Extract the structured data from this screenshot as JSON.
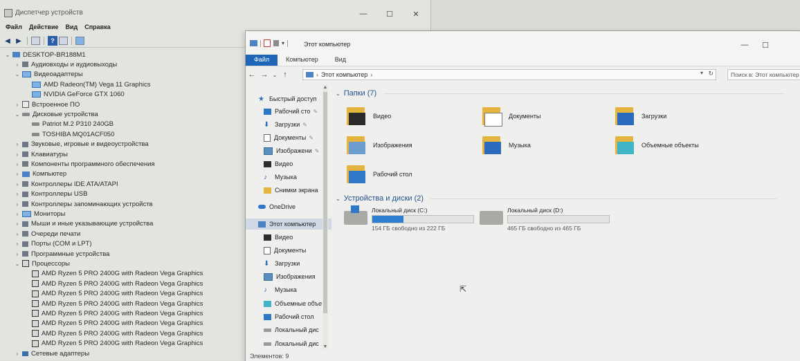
{
  "device_manager": {
    "title": "Диспетчер устройств",
    "window_controls": {
      "minimize": "—",
      "maximize": "☐",
      "close": "✕"
    },
    "menu": [
      "Файл",
      "Действие",
      "Вид",
      "Справка"
    ],
    "tree": [
      {
        "label": "DESKTOP-BR188M1",
        "level": 0,
        "expanded": true,
        "icon": "computer-icon"
      },
      {
        "label": "Аудиовходы и аудиовыходы",
        "level": 1,
        "expanded": false,
        "icon": "speaker-icon"
      },
      {
        "label": "Видеоадаптеры",
        "level": 1,
        "expanded": true,
        "icon": "monitor-icon"
      },
      {
        "label": "AMD Radeon(TM) Vega 11 Graphics",
        "level": 2,
        "icon": "monitor-icon"
      },
      {
        "label": "NVIDIA GeForce GTX 1060",
        "level": 2,
        "icon": "monitor-icon"
      },
      {
        "label": "Встроенное ПО",
        "level": 1,
        "expanded": false,
        "icon": "chip-icon"
      },
      {
        "label": "Дисковые устройства",
        "level": 1,
        "expanded": true,
        "icon": "disk-icon"
      },
      {
        "label": "Patriot M.2 P310 240GB",
        "level": 2,
        "icon": "disk-icon"
      },
      {
        "label": "TOSHIBA MQ01ACF050",
        "level": 2,
        "icon": "disk-icon"
      },
      {
        "label": "Звуковые, игровые и видеоустройства",
        "level": 1,
        "expanded": false,
        "icon": "speaker-icon"
      },
      {
        "label": "Клавиатуры",
        "level": 1,
        "expanded": false,
        "icon": "keyboard-icon"
      },
      {
        "label": "Компоненты программного обеспечения",
        "level": 1,
        "expanded": false,
        "icon": "component-icon"
      },
      {
        "label": "Компьютер",
        "level": 1,
        "expanded": false,
        "icon": "computer-icon"
      },
      {
        "label": "Контроллеры IDE ATA/ATAPI",
        "level": 1,
        "expanded": false,
        "icon": "controller-icon"
      },
      {
        "label": "Контроллеры USB",
        "level": 1,
        "expanded": false,
        "icon": "usb-icon"
      },
      {
        "label": "Контроллеры запоминающих устройств",
        "level": 1,
        "expanded": false,
        "icon": "storage-controller-icon"
      },
      {
        "label": "Мониторы",
        "level": 1,
        "expanded": false,
        "icon": "monitor-icon"
      },
      {
        "label": "Мыши и иные указывающие устройства",
        "level": 1,
        "expanded": false,
        "icon": "mouse-icon"
      },
      {
        "label": "Очереди печати",
        "level": 1,
        "expanded": false,
        "icon": "printer-icon"
      },
      {
        "label": "Порты (COM и LPT)",
        "level": 1,
        "expanded": false,
        "icon": "port-icon"
      },
      {
        "label": "Программные устройства",
        "level": 1,
        "expanded": false,
        "icon": "component-icon"
      },
      {
        "label": "Процессоры",
        "level": 1,
        "expanded": true,
        "icon": "cpu-icon"
      },
      {
        "label": "AMD Ryzen 5 PRO 2400G with Radeon Vega Graphics",
        "level": 2,
        "icon": "cpu-icon"
      },
      {
        "label": "AMD Ryzen 5 PRO 2400G with Radeon Vega Graphics",
        "level": 2,
        "icon": "cpu-icon"
      },
      {
        "label": "AMD Ryzen 5 PRO 2400G with Radeon Vega Graphics",
        "level": 2,
        "icon": "cpu-icon"
      },
      {
        "label": "AMD Ryzen 5 PRO 2400G with Radeon Vega Graphics",
        "level": 2,
        "icon": "cpu-icon"
      },
      {
        "label": "AMD Ryzen 5 PRO 2400G with Radeon Vega Graphics",
        "level": 2,
        "icon": "cpu-icon"
      },
      {
        "label": "AMD Ryzen 5 PRO 2400G with Radeon Vega Graphics",
        "level": 2,
        "icon": "cpu-icon"
      },
      {
        "label": "AMD Ryzen 5 PRO 2400G with Radeon Vega Graphics",
        "level": 2,
        "icon": "cpu-icon"
      },
      {
        "label": "AMD Ryzen 5 PRO 2400G with Radeon Vega Graphics",
        "level": 2,
        "icon": "cpu-icon"
      },
      {
        "label": "Сетевые адаптеры",
        "level": 1,
        "expanded": false,
        "icon": "network-icon"
      }
    ]
  },
  "explorer": {
    "title": "Этот компьютер",
    "ribbon_tabs": [
      "Файл",
      "Компьютер",
      "Вид"
    ],
    "address": "Этот компьютер",
    "search_placeholder": "Поиск в: Этот компьютер",
    "nav": [
      {
        "label": "Быстрый доступ",
        "icon": "star-icon",
        "pinned": false
      },
      {
        "label": "Рабочий сто",
        "icon": "desktop-icon",
        "pinned": true
      },
      {
        "label": "Загрузки",
        "icon": "download-icon",
        "pinned": true
      },
      {
        "label": "Документы",
        "icon": "document-icon",
        "pinned": true
      },
      {
        "label": "Изображени",
        "icon": "image-icon",
        "pinned": true
      },
      {
        "label": "Видео",
        "icon": "video-icon",
        "pinned": false
      },
      {
        "label": "Музыка",
        "icon": "music-icon",
        "pinned": false
      },
      {
        "label": "Снимки экрана",
        "icon": "folder-icon",
        "pinned": false
      },
      {
        "label": "OneDrive",
        "icon": "cloud-icon",
        "pinned": false
      },
      {
        "label": "Этот компьютер",
        "icon": "computer-icon",
        "pinned": false,
        "selected": true
      },
      {
        "label": "Видео",
        "icon": "video-icon",
        "pinned": false
      },
      {
        "label": "Документы",
        "icon": "document-icon",
        "pinned": false
      },
      {
        "label": "Загрузки",
        "icon": "download-icon",
        "pinned": false
      },
      {
        "label": "Изображения",
        "icon": "image-icon",
        "pinned": false
      },
      {
        "label": "Музыка",
        "icon": "music-icon",
        "pinned": false
      },
      {
        "label": "Объемные объе",
        "icon": "cube-icon",
        "pinned": false
      },
      {
        "label": "Рабочий стол",
        "icon": "desktop-icon",
        "pinned": false
      },
      {
        "label": "Локальный дис",
        "icon": "drive-icon",
        "pinned": false
      },
      {
        "label": "Локальный дис",
        "icon": "drive-icon",
        "pinned": false
      }
    ],
    "folders_header": "Папки (7)",
    "folders": [
      {
        "label": "Видео",
        "icon": "video-folder-icon"
      },
      {
        "label": "Документы",
        "icon": "documents-folder-icon"
      },
      {
        "label": "Загрузки",
        "icon": "downloads-folder-icon"
      },
      {
        "label": "Изображения",
        "icon": "pictures-folder-icon"
      },
      {
        "label": "Музыка",
        "icon": "music-folder-icon"
      },
      {
        "label": "Объемные объекты",
        "icon": "3d-objects-folder-icon"
      },
      {
        "label": "Рабочий стол",
        "icon": "desktop-folder-icon"
      }
    ],
    "drives_header": "Устройства и диски (2)",
    "drives": [
      {
        "label": "Локальный диск (C:)",
        "free": "154 ГБ свободно из 222 ГБ",
        "used_fraction": 0.31,
        "system": true
      },
      {
        "label": "Локальный диск (D:)",
        "free": "465 ГБ свободно из 465 ГБ",
        "used_fraction": 0.0,
        "system": false
      }
    ],
    "status": "Элементов: 9",
    "accent_color": "#1f66b8"
  }
}
